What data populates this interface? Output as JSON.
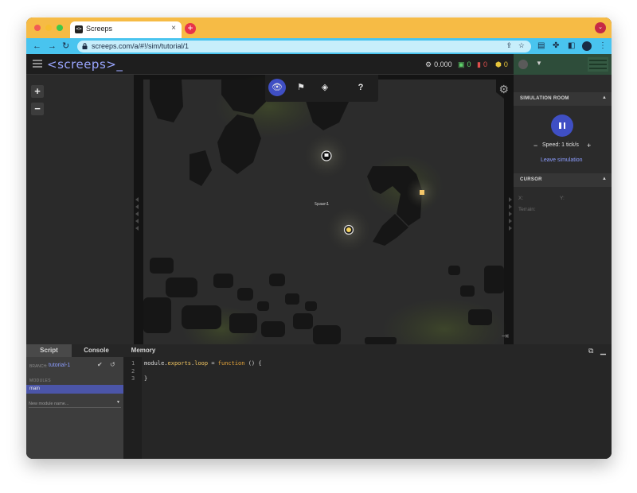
{
  "browser": {
    "tab_title": "Screeps",
    "tab_icon": "<>",
    "tab_close": "×",
    "new_tab": "+",
    "url": "screeps.com/a/#!/sim/tutorial/1",
    "nav": {
      "back": "←",
      "forward": "→",
      "reload": "↻"
    },
    "colors": {
      "tabbar": "#f6bb45",
      "toolbar": "#49c4ef"
    }
  },
  "header": {
    "logo": "<screeps>_",
    "stats": [
      {
        "icon": "cpu-icon",
        "glyph": "⚙",
        "value": "0.000",
        "color": "#d8d8d8"
      },
      {
        "icon": "gcl-icon",
        "glyph": "▣",
        "value": "0",
        "color": "#5fd06a"
      },
      {
        "icon": "rooms-icon",
        "glyph": "▮",
        "value": "0",
        "color": "#e0504d"
      },
      {
        "icon": "energy-icon",
        "glyph": "⬢",
        "value": "0",
        "color": "#e6c43a"
      }
    ]
  },
  "map": {
    "zoom_in": "+",
    "zoom_out": "−",
    "toolbar": {
      "view": "👁",
      "flag": "⚑",
      "construct": "◈",
      "help": "?"
    },
    "spawn_label": "Spawn1"
  },
  "sim": {
    "title": "SIMULATION ROOM",
    "speed_minus": "−",
    "speed": "Speed: 1 tick/s",
    "speed_plus": "+",
    "leave": "Leave simulation"
  },
  "cursor": {
    "title": "CURSOR",
    "x_label": "X:",
    "y_label": "Y:",
    "terrain_label": "Terrain:"
  },
  "bottom": {
    "tabs": [
      "Script",
      "Console",
      "Memory"
    ],
    "branch_label": "BRANCH:",
    "branch": "tutorial-1",
    "modules_label": "MODULES",
    "modules": [
      "main"
    ],
    "new_module_placeholder": "New module name...",
    "code_lines": [
      {
        "num": "1",
        "parts": [
          [
            "module.",
            ""
          ],
          [
            "exports",
            "c-prop"
          ],
          [
            ".",
            ""
          ],
          [
            "loop",
            "c-prop"
          ],
          [
            " = ",
            ""
          ],
          [
            "function",
            "c-kw"
          ],
          [
            " () {",
            ""
          ]
        ]
      },
      {
        "num": "2",
        "parts": [
          [
            "",
            ""
          ]
        ]
      },
      {
        "num": "3",
        "parts": [
          [
            "}",
            ""
          ]
        ]
      }
    ]
  }
}
